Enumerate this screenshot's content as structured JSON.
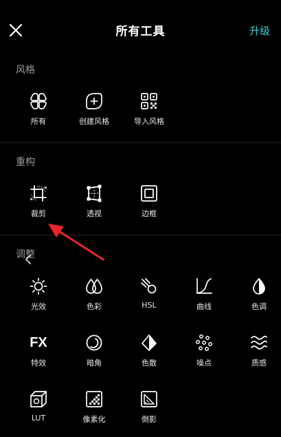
{
  "header": {
    "title": "所有工具",
    "upgrade": "升级"
  },
  "sections": {
    "style": {
      "title": "风格",
      "items": [
        {
          "label": "所有",
          "icon": "four-petal-icon"
        },
        {
          "label": "创建风格",
          "icon": "add-style-icon"
        },
        {
          "label": "导入风格",
          "icon": "qr-code-icon"
        }
      ]
    },
    "rebuild": {
      "title": "重构",
      "items": [
        {
          "label": "裁剪",
          "icon": "crop-icon"
        },
        {
          "label": "透视",
          "icon": "perspective-icon"
        },
        {
          "label": "边框",
          "icon": "frame-icon"
        }
      ]
    },
    "adjust": {
      "title": "调整",
      "rows": [
        [
          {
            "label": "光效",
            "icon": "sun-icon"
          },
          {
            "label": "色彩",
            "icon": "color-drops-icon"
          },
          {
            "label": "HSL",
            "icon": "comet-icon"
          },
          {
            "label": "曲线",
            "icon": "curve-icon"
          },
          {
            "label": "色调",
            "icon": "drop-icon"
          }
        ],
        [
          {
            "label": "特效",
            "icon": "fx-icon",
            "glyph": "FX"
          },
          {
            "label": "暗角",
            "icon": "vignette-icon"
          },
          {
            "label": "色散",
            "icon": "prism-icon"
          },
          {
            "label": "噪点",
            "icon": "grain-dots-icon"
          },
          {
            "label": "质感",
            "icon": "waves-icon"
          }
        ],
        [
          {
            "label": "LUT",
            "icon": "cube-icon"
          },
          {
            "label": "像素化",
            "icon": "pixelate-icon"
          },
          {
            "label": "倒影",
            "icon": "reflection-icon"
          }
        ]
      ]
    }
  },
  "colors": {
    "accent": "#3ecfd6",
    "annotation": "#e8262a",
    "background": "#000000"
  }
}
